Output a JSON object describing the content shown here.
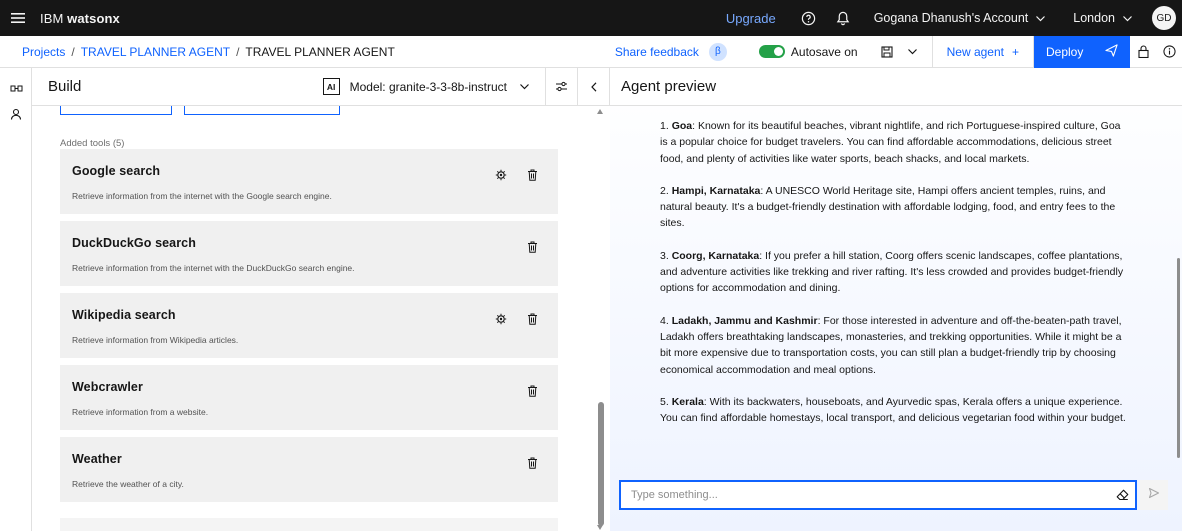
{
  "topbar": {
    "brand_prefix": "IBM",
    "brand_name": "watsonx",
    "upgrade": "Upgrade",
    "account": "Gogana Dhanush's Account",
    "region": "London",
    "avatar_initials": "GD"
  },
  "subbar": {
    "breadcrumb": [
      "Projects",
      "TRAVEL PLANNER AGENT",
      "TRAVEL PLANNER AGENT"
    ],
    "separator": "/",
    "share_feedback": "Share feedback",
    "beta": "β",
    "autosave": "Autosave on",
    "autosave_enabled": true,
    "new_agent": "New agent",
    "new_agent_icon": "+",
    "deploy": "Deploy"
  },
  "build": {
    "title": "Build",
    "ai_badge": "AI",
    "model": "Model: granite-3-3-8b-instruct",
    "added_tools_label": "Added tools (5)",
    "tools": [
      {
        "name": "Google search",
        "description": "Retrieve information from the internet with the Google search engine.",
        "has_settings": true
      },
      {
        "name": "DuckDuckGo search",
        "description": "Retrieve information from the internet with the DuckDuckGo search engine.",
        "has_settings": false
      },
      {
        "name": "Wikipedia search",
        "description": "Retrieve information from Wikipedia articles.",
        "has_settings": true
      },
      {
        "name": "Webcrawler",
        "description": "Retrieve information from a website.",
        "has_settings": false
      },
      {
        "name": "Weather",
        "description": "Retrieve the weather of a city.",
        "has_settings": false
      }
    ]
  },
  "preview": {
    "title": "Agent preview",
    "items": [
      {
        "num": "1.",
        "place": "Goa",
        "text": ": Known for its beautiful beaches, vibrant nightlife, and rich Portuguese-inspired culture, Goa is a popular choice for budget travelers. You can find affordable accommodations, delicious street food, and plenty of activities like water sports, beach shacks, and local markets."
      },
      {
        "num": "2.",
        "place": "Hampi, Karnataka",
        "text": ": A UNESCO World Heritage site, Hampi offers ancient temples, ruins, and natural beauty. It's a budget-friendly destination with affordable lodging, food, and entry fees to the sites."
      },
      {
        "num": "3.",
        "place": "Coorg, Karnataka",
        "text": ": If you prefer a hill station, Coorg offers scenic landscapes, coffee plantations, and adventure activities like trekking and river rafting. It's less crowded and provides budget-friendly options for accommodation and dining."
      },
      {
        "num": "4.",
        "place": "Ladakh, Jammu and Kashmir",
        "text": ": For those interested in adventure and off-the-beaten-path travel, Ladakh offers breathtaking landscapes, monasteries, and trekking opportunities. While it might be a bit more expensive due to transportation costs, you can still plan a budget-friendly trip by choosing economical accommodation and meal options."
      },
      {
        "num": "5.",
        "place": "Kerala",
        "text": ": With its backwaters, houseboats, and Ayurvedic spas, Kerala offers a unique experience. You can find affordable homestays, local transport, and delicious vegetarian food within your budget."
      }
    ],
    "input_placeholder": "Type something..."
  },
  "colors": {
    "brand_blue": "#0f62fe",
    "topbar_bg": "#161616",
    "toggle_green": "#24a148",
    "card_bg": "#f0f0f0"
  },
  "icons": [
    "hamburger-icon",
    "help-icon",
    "notification-icon",
    "save-icon",
    "send-icon",
    "lock-icon",
    "info-icon",
    "settings-icon",
    "trash-icon",
    "eraser-icon",
    "chevron-down-icon",
    "chevron-left-icon",
    "sliders-icon",
    "flow-icon",
    "agent-icon"
  ]
}
